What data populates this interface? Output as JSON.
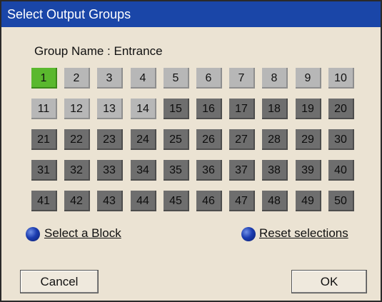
{
  "window": {
    "title": "Select Output Groups"
  },
  "group_name": "Group Name : Entrance",
  "groups": [
    {
      "num": "1",
      "state": "selected"
    },
    {
      "num": "2",
      "state": "light"
    },
    {
      "num": "3",
      "state": "light"
    },
    {
      "num": "4",
      "state": "light"
    },
    {
      "num": "5",
      "state": "light"
    },
    {
      "num": "6",
      "state": "light"
    },
    {
      "num": "7",
      "state": "light"
    },
    {
      "num": "8",
      "state": "light"
    },
    {
      "num": "9",
      "state": "light"
    },
    {
      "num": "10",
      "state": "light"
    },
    {
      "num": "11",
      "state": "light"
    },
    {
      "num": "12",
      "state": "light"
    },
    {
      "num": "13",
      "state": "light"
    },
    {
      "num": "14",
      "state": "light"
    },
    {
      "num": "15",
      "state": "dark"
    },
    {
      "num": "16",
      "state": "dark"
    },
    {
      "num": "17",
      "state": "dark"
    },
    {
      "num": "18",
      "state": "dark"
    },
    {
      "num": "19",
      "state": "dark"
    },
    {
      "num": "20",
      "state": "dark"
    },
    {
      "num": "21",
      "state": "dark"
    },
    {
      "num": "22",
      "state": "dark"
    },
    {
      "num": "23",
      "state": "dark"
    },
    {
      "num": "24",
      "state": "dark"
    },
    {
      "num": "25",
      "state": "dark"
    },
    {
      "num": "26",
      "state": "dark"
    },
    {
      "num": "27",
      "state": "dark"
    },
    {
      "num": "28",
      "state": "dark"
    },
    {
      "num": "29",
      "state": "dark"
    },
    {
      "num": "30",
      "state": "dark"
    },
    {
      "num": "31",
      "state": "dark"
    },
    {
      "num": "32",
      "state": "dark"
    },
    {
      "num": "33",
      "state": "dark"
    },
    {
      "num": "34",
      "state": "dark"
    },
    {
      "num": "35",
      "state": "dark"
    },
    {
      "num": "36",
      "state": "dark"
    },
    {
      "num": "37",
      "state": "dark"
    },
    {
      "num": "38",
      "state": "dark"
    },
    {
      "num": "39",
      "state": "dark"
    },
    {
      "num": "40",
      "state": "dark"
    },
    {
      "num": "41",
      "state": "dark"
    },
    {
      "num": "42",
      "state": "dark"
    },
    {
      "num": "43",
      "state": "dark"
    },
    {
      "num": "44",
      "state": "dark"
    },
    {
      "num": "45",
      "state": "dark"
    },
    {
      "num": "46",
      "state": "dark"
    },
    {
      "num": "47",
      "state": "dark"
    },
    {
      "num": "48",
      "state": "dark"
    },
    {
      "num": "49",
      "state": "dark"
    },
    {
      "num": "50",
      "state": "dark"
    }
  ],
  "links": {
    "select_block": "Select a Block",
    "reset_selections": "Reset selections"
  },
  "buttons": {
    "cancel": "Cancel",
    "ok": "OK"
  },
  "colors": {
    "titlebar": "#1a46a8",
    "selected": "#5ab82e",
    "available": "#b7b7b7",
    "unavailable": "#6e6e6e",
    "link_icon": "#1b3cb0"
  },
  "icons": {
    "link_bullet": "blue-sphere-icon"
  }
}
